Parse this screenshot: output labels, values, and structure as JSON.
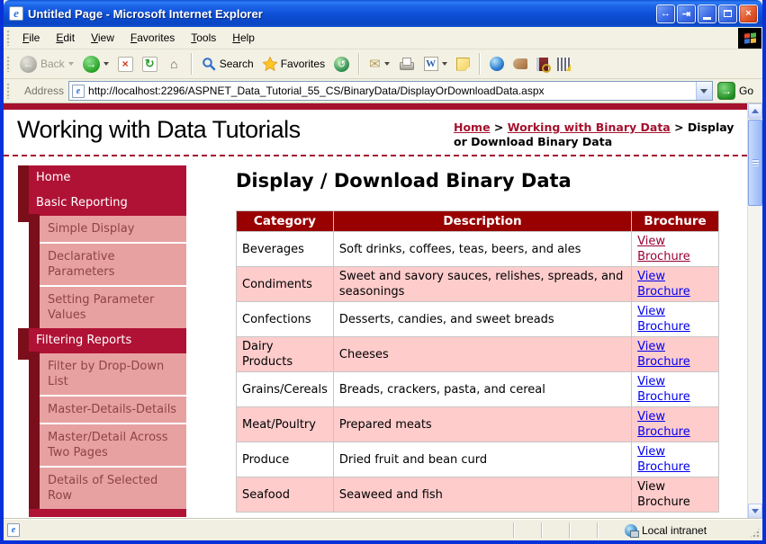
{
  "window": {
    "title": "Untitled Page - Microsoft Internet Explorer"
  },
  "menu": {
    "items": [
      "File",
      "Edit",
      "View",
      "Favorites",
      "Tools",
      "Help"
    ]
  },
  "toolbar": {
    "back": "Back",
    "search": "Search",
    "favorites": "Favorites"
  },
  "address": {
    "label": "Address",
    "url": "http://localhost:2296/ASPNET_Data_Tutorial_55_CS/BinaryData/DisplayOrDownloadData.aspx",
    "go": "Go"
  },
  "header": {
    "site_title": "Working with Data Tutorials",
    "breadcrumb": {
      "home": "Home",
      "sep1": " > ",
      "section": "Working with Binary Data",
      "sep2": " > ",
      "current": "Display or Download Binary Data"
    }
  },
  "sidebar": {
    "items": [
      {
        "label": "Home",
        "type": "header"
      },
      {
        "label": "Basic Reporting",
        "type": "header"
      },
      {
        "label": "Simple Display",
        "type": "sub"
      },
      {
        "label": "Declarative Parameters",
        "type": "sub"
      },
      {
        "label": "Setting Parameter Values",
        "type": "sub"
      },
      {
        "label": "Filtering Reports",
        "type": "header"
      },
      {
        "label": "Filter by Drop-Down List",
        "type": "sub"
      },
      {
        "label": "Master-Details-Details",
        "type": "sub"
      },
      {
        "label": "Master/Detail Across Two Pages",
        "type": "sub"
      },
      {
        "label": "Details of Selected Row",
        "type": "sub"
      }
    ]
  },
  "main": {
    "heading": "Display / Download Binary Data",
    "table": {
      "headers": [
        "Category",
        "Description",
        "Brochure"
      ],
      "rows": [
        {
          "category": "Beverages",
          "description": "Soft drinks, coffees, teas, beers, and ales",
          "brochure": "View Brochure",
          "brochure_style": "visited"
        },
        {
          "category": "Condiments",
          "description": "Sweet and savory sauces, relishes, spreads, and seasonings",
          "brochure": "View Brochure",
          "brochure_style": "link"
        },
        {
          "category": "Confections",
          "description": "Desserts, candies, and sweet breads",
          "brochure": "View Brochure",
          "brochure_style": "link"
        },
        {
          "category": "Dairy Products",
          "description": "Cheeses",
          "brochure": "View Brochure",
          "brochure_style": "link"
        },
        {
          "category": "Grains/Cereals",
          "description": "Breads, crackers, pasta, and cereal",
          "brochure": "View Brochure",
          "brochure_style": "link"
        },
        {
          "category": "Meat/Poultry",
          "description": "Prepared meats",
          "brochure": "View Brochure",
          "brochure_style": "link"
        },
        {
          "category": "Produce",
          "description": "Dried fruit and bean curd",
          "brochure": "View Brochure",
          "brochure_style": "link"
        },
        {
          "category": "Seafood",
          "description": "Seaweed and fish",
          "brochure": "View Brochure",
          "brochure_style": "plain"
        }
      ]
    }
  },
  "status": {
    "zone": "Local intranet"
  },
  "colors": {
    "crimson": "#B01235",
    "dark_maroon": "#7B0E1B",
    "menu_pink": "#E7A1A1",
    "sub_text": "#904444",
    "table_header": "#990000",
    "row_pink": "#FFCCCC",
    "link_blue": "#0000EE",
    "link_visited": "#990033",
    "accent_red": "#A5122E"
  }
}
